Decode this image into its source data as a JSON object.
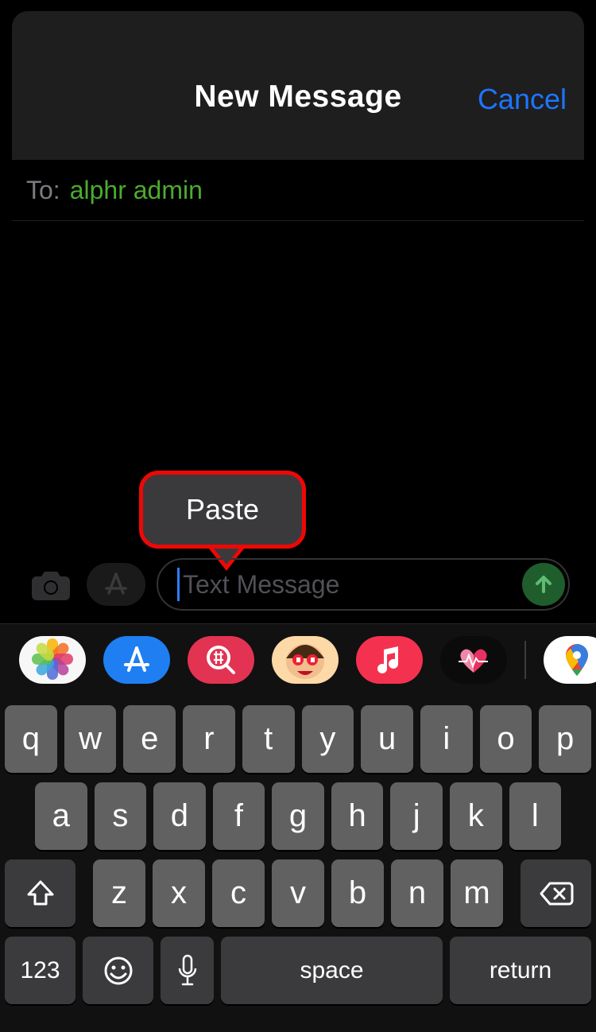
{
  "header": {
    "title": "New Message",
    "cancel": "Cancel"
  },
  "to": {
    "label": "To:",
    "recipient": "alphr admin"
  },
  "compose": {
    "placeholder": "Text Message",
    "paste_menu": "Paste"
  },
  "app_strip": {
    "photos": "photos",
    "appstore": "appstore",
    "gif_search": "gif-search",
    "memoji": "memoji",
    "music": "music",
    "fitness": "fitness",
    "maps": "maps"
  },
  "keyboard": {
    "row1": [
      "q",
      "w",
      "e",
      "r",
      "t",
      "y",
      "u",
      "i",
      "o",
      "p"
    ],
    "row2": [
      "a",
      "s",
      "d",
      "f",
      "g",
      "h",
      "j",
      "k",
      "l"
    ],
    "row3": [
      "z",
      "x",
      "c",
      "v",
      "b",
      "n",
      "m"
    ],
    "numbers": "123",
    "space": "space",
    "return": "return"
  }
}
